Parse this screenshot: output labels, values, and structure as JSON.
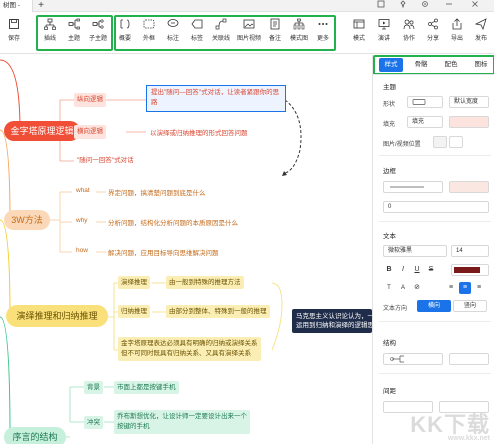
{
  "titlebar": {
    "tab_title": "树图 - ",
    "add_tab": "+",
    "controls": [
      "☐",
      "📌",
      "⚙",
      "—",
      "✕"
    ]
  },
  "toolbar": {
    "save": "保存",
    "left_group": [
      "插线",
      "主题",
      "子主题"
    ],
    "mid_group": [
      "概要",
      "外框",
      "标注",
      "标签",
      "关联线",
      "图片视频",
      "备注",
      "模式图",
      "更多"
    ],
    "right_group": [
      "模式",
      "演讲",
      "协作",
      "分享",
      "导出",
      "发布"
    ],
    "accent": "#22b14c"
  },
  "mindmap": {
    "branch1": {
      "root": "金字塔原理逻辑",
      "color": "#f04e37",
      "children": [
        "纵向逻辑",
        "横向逻辑",
        "\"随问一回答\"式对话"
      ],
      "leaves": [
        "提出\"随问—回答\"式对话，让读者紧跟你的思路",
        "以演绎或归纳推理的形式回答问题"
      ]
    },
    "branch2": {
      "root": "3W方法",
      "color": "#f7a85a",
      "children": [
        "what",
        "why",
        "how"
      ],
      "leaves": [
        "界定问题，搞清楚问题到底是什么",
        "分析问题，结构化分析问题的本质原因是什么",
        "解决问题，应用目标导向思维解决问题"
      ]
    },
    "branch3": {
      "root": "演绎推理和归纳推理",
      "color": "#f5cc2b",
      "children": [
        "演绎推理",
        "归纳推理",
        "金字塔原理表达必须具有明确的归纳或演绎关系\n但不可同时既具有归纳关系、又具有演绎关系"
      ],
      "leaves": [
        "由一般到特殊的推理方法",
        "由部分到整体、特殊到一般的推理"
      ],
      "callout": "马克思主义认识论认为，一\n运用到归纳和演绎的逻辑思"
    },
    "branch4": {
      "root": "序言的结构",
      "color": "#3cc38a",
      "children": [
        "背景",
        "冲突"
      ],
      "leaves": [
        "市面上都是按键手机",
        "乔布斯想优化，让设计师一定要设计出来一个\n按键的手机"
      ]
    }
  },
  "panel": {
    "tabs": [
      "样式",
      "骨骼",
      "配色",
      "图标"
    ],
    "active_tab": "样式",
    "topic_section": "主题",
    "shape_label": "形状",
    "shape_value": "默认宽度",
    "fill_label": "填充",
    "fill_value": "填充",
    "image_pos_label": "图片/视频位置",
    "border_section": "边框",
    "border_width": "0",
    "text_section": "文本",
    "font_family": "微软雅黑",
    "font_size": "14",
    "font_color": "#7a1a1a",
    "text_dir_label": "文本方向",
    "text_dir_h": "横向",
    "text_dir_v": "竖向",
    "structure_section": "结构",
    "spacing_section": "间距"
  },
  "watermark": {
    "big": "KK下载",
    "small": "www.kkx.net"
  }
}
